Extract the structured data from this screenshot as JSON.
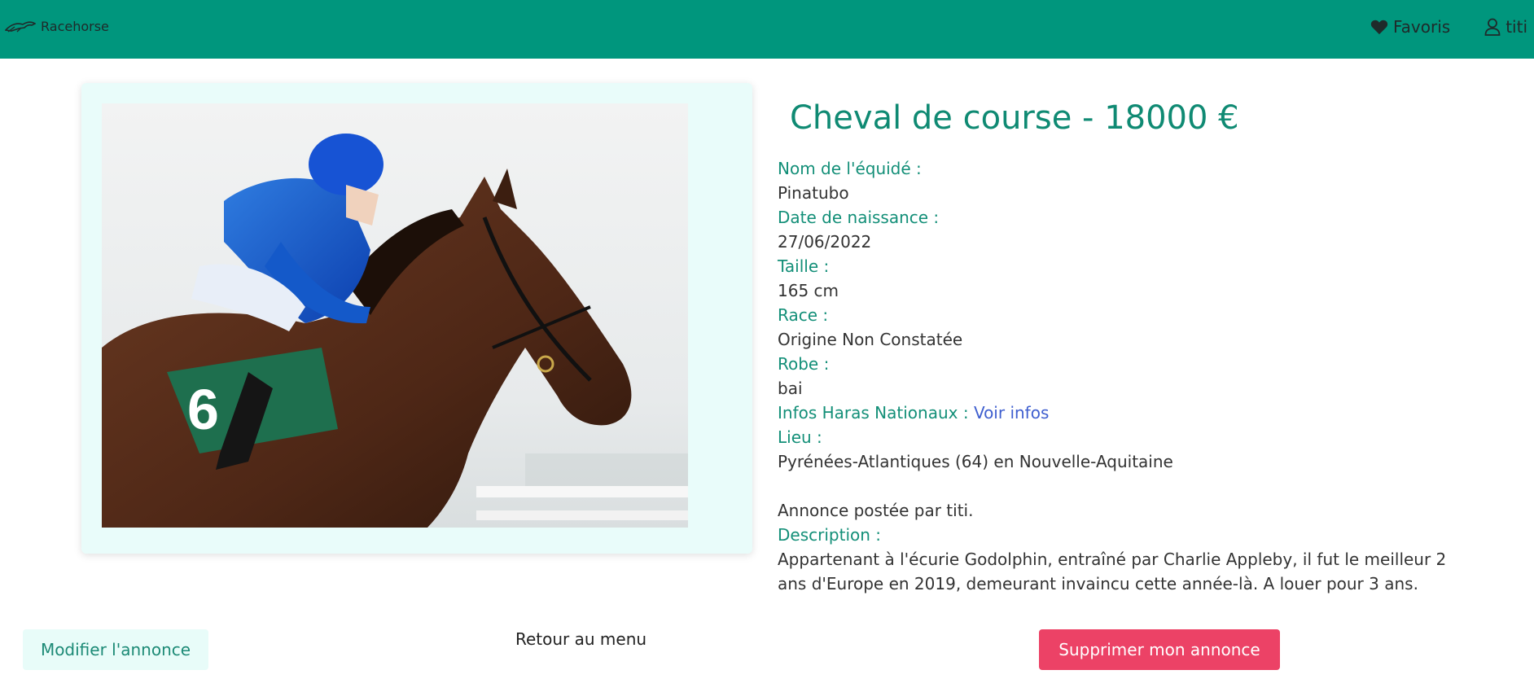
{
  "navbar": {
    "brand": "Racehorse",
    "favorites_label": "Favoris",
    "user_label": "titi"
  },
  "listing": {
    "title": "Cheval de course - 18000 €",
    "photo_icon": "racehorse-photo",
    "fields": {
      "name_label": "Nom de l'équidé :",
      "name_value": "Pinatubo",
      "birth_label": "Date de naissance :",
      "birth_value": "27/06/2022",
      "height_label": "Taille :",
      "height_value": "165 cm",
      "breed_label": "Race :",
      "breed_value": "Origine Non Constatée",
      "coat_label": "Robe :",
      "coat_value": "bai",
      "haras_label": "Infos Haras Nationaux :",
      "haras_link": "Voir infos",
      "location_label": "Lieu :",
      "location_value": "Pyrénées-Atlantiques (64) en Nouvelle-Aquitaine"
    },
    "posted_by": "Annonce postée par titi.",
    "description_label": "Description :",
    "description": "Appartenant à l'écurie Godolphin, entraîné par Charlie Appleby, il fut le meilleur 2 ans d'Europe en 2019, demeurant invaincu cette année-là. A louer pour 3 ans."
  },
  "actions": {
    "edit_label": "Modifier l'annonce",
    "back_label": "Retour au menu",
    "delete_label": "Supprimer mon annonce"
  },
  "colors": {
    "navbar": "#00967d",
    "accent_text": "#138f78",
    "card_bg": "#e9fcfa",
    "delete": "#ec4266",
    "link": "#3f5fcf"
  }
}
